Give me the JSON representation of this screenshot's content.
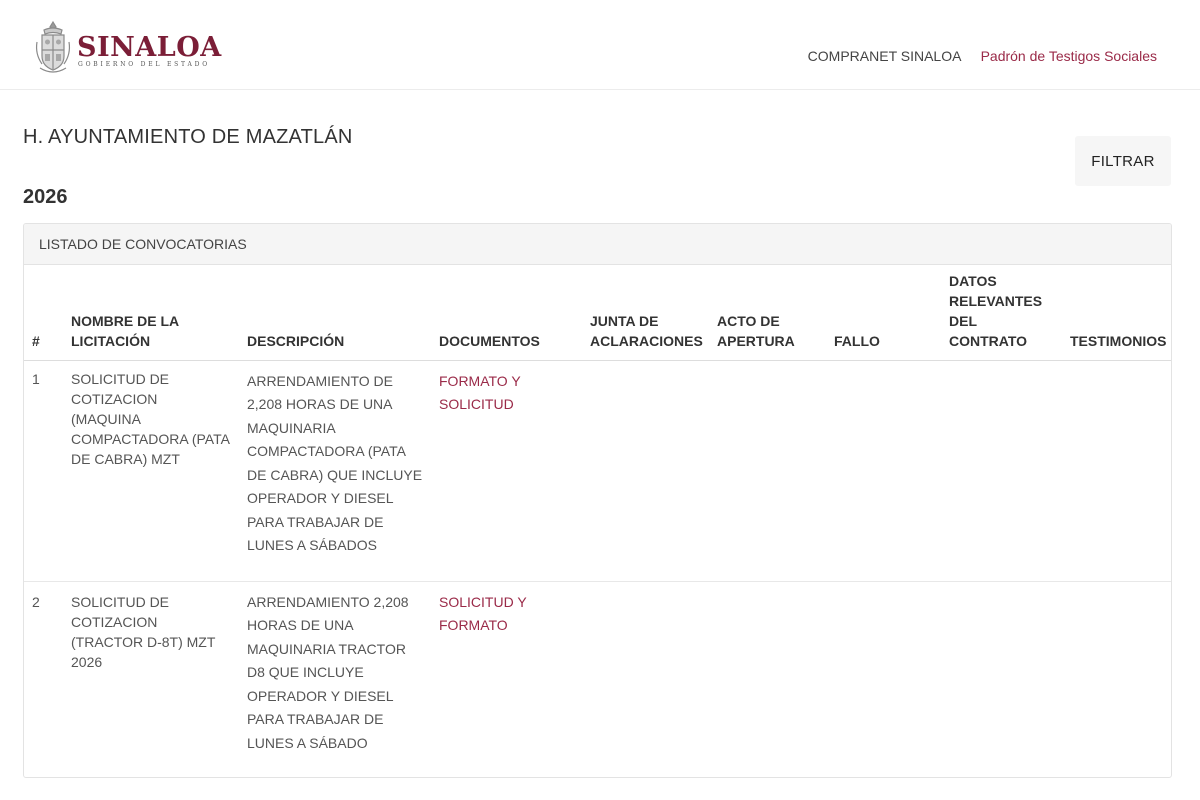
{
  "header": {
    "brand": "SINALOA",
    "brand_sub": "GOBIERNO DEL ESTADO",
    "nav": {
      "compranet": "COMPRANET SINALOA",
      "padron": "Padrón de Testigos Sociales"
    }
  },
  "page": {
    "entity_title": "H. AYUNTAMIENTO DE MAZATLÁN",
    "year": "2026",
    "filter_label": "FILTRAR"
  },
  "panel": {
    "heading": "LISTADO DE CONVOCATORIAS"
  },
  "table": {
    "columns": {
      "num": "#",
      "nombre": "NOMBRE DE LA LICITACIÓN",
      "descripcion": "DESCRIPCIÓN",
      "documentos": "DOCUMENTOS",
      "junta": "JUNTA DE ACLARACIONES",
      "acto": "ACTO DE APERTURA",
      "fallo": "FALLO",
      "datos": "DATOS RELEVANTES DEL CONTRATO",
      "testimonios": "TESTIMONIOS"
    },
    "rows": [
      {
        "num": "1",
        "nombre": "SOLICITUD DE COTIZACION (MAQUINA COMPACTADORA (PATA DE CABRA) MZT",
        "descripcion": "ARRENDAMIENTO DE 2,208 HORAS DE UNA MAQUINARIA COMPACTADORA (PATA DE CABRA) QUE INCLUYE OPERADOR Y DIESEL PARA TRABAJAR DE LUNES A SÁBADOS",
        "documento": "FORMATO Y SOLICITUD",
        "junta": "",
        "acto": "",
        "fallo": "",
        "datos": "",
        "testimonios": ""
      },
      {
        "num": "2",
        "nombre": "SOLICITUD DE COTIZACION (TRACTOR D-8T) MZT 2026",
        "descripcion": "ARRENDAMIENTO 2,208 HORAS DE UNA MAQUINARIA TRACTOR D8 QUE INCLUYE OPERADOR Y DIESEL PARA TRABAJAR DE LUNES A SÁBADO",
        "documento": "SOLICITUD Y FORMATO",
        "junta": "",
        "acto": "",
        "fallo": "",
        "datos": "",
        "testimonios": ""
      }
    ]
  },
  "colors": {
    "brand": "#7b1e37",
    "link": "#9a2a48",
    "text": "#333333",
    "panel_heading_bg": "#f5f5f5"
  },
  "icons": {
    "logo": "sinaloa-coat-of-arms-icon"
  }
}
